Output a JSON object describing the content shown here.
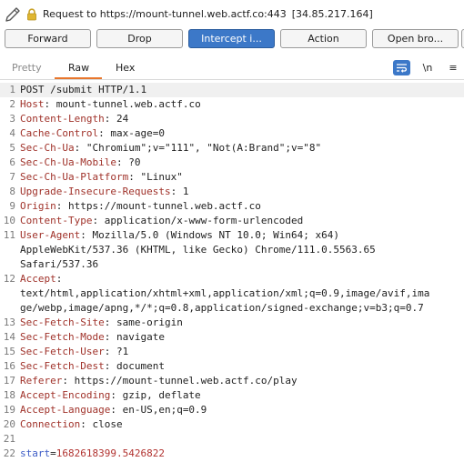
{
  "request_bar": {
    "text": "Request to https://mount-tunnel.web.actf.co:443",
    "address": "[34.85.217.164]"
  },
  "buttons": {
    "forward": "Forward",
    "drop": "Drop",
    "intercept": "Intercept i...",
    "action": "Action",
    "open_browser": "Open bro..."
  },
  "tabs": {
    "pretty": "Pretty",
    "raw": "Raw",
    "hex": "Hex"
  },
  "tools": {
    "newline": "\\n",
    "menu": "≡"
  },
  "colors": {
    "accent": "#3c78c8",
    "tab_underline": "#e8762c",
    "header_name": "#a0322a",
    "param_name": "#3d5cc6",
    "param_value": "#b1322f"
  },
  "lines": [
    {
      "n": "1",
      "plain": "POST /submit HTTP/1.1"
    },
    {
      "n": "2",
      "key": "Host",
      "val": "mount-tunnel.web.actf.co"
    },
    {
      "n": "3",
      "key": "Content-Length",
      "val": "24"
    },
    {
      "n": "4",
      "key": "Cache-Control",
      "val": "max-age=0"
    },
    {
      "n": "5",
      "key": "Sec-Ch-Ua",
      "val": "\"Chromium\";v=\"111\", \"Not(A:Brand\";v=\"8\""
    },
    {
      "n": "6",
      "key": "Sec-Ch-Ua-Mobile",
      "val": "?0"
    },
    {
      "n": "7",
      "key": "Sec-Ch-Ua-Platform",
      "val": "\"Linux\""
    },
    {
      "n": "8",
      "key": "Upgrade-Insecure-Requests",
      "val": "1"
    },
    {
      "n": "9",
      "key": "Origin",
      "val": "https://mount-tunnel.web.actf.co"
    },
    {
      "n": "10",
      "key": "Content-Type",
      "val": "application/x-www-form-urlencoded"
    },
    {
      "n": "11",
      "key": "User-Agent",
      "val": "Mozilla/5.0 (Windows NT 10.0; Win64; x64)"
    },
    {
      "n": "",
      "plain": "AppleWebKit/537.36 (KHTML, like Gecko) Chrome/111.0.5563.65"
    },
    {
      "n": "",
      "plain": "Safari/537.36"
    },
    {
      "n": "12",
      "key": "Accept",
      "val": ""
    },
    {
      "n": "",
      "plain": "text/html,application/xhtml+xml,application/xml;q=0.9,image/avif,ima"
    },
    {
      "n": "",
      "plain": "ge/webp,image/apng,*/*;q=0.8,application/signed-exchange;v=b3;q=0.7"
    },
    {
      "n": "13",
      "key": "Sec-Fetch-Site",
      "val": "same-origin"
    },
    {
      "n": "14",
      "key": "Sec-Fetch-Mode",
      "val": "navigate"
    },
    {
      "n": "15",
      "key": "Sec-Fetch-User",
      "val": "?1"
    },
    {
      "n": "16",
      "key": "Sec-Fetch-Dest",
      "val": "document"
    },
    {
      "n": "17",
      "key": "Referer",
      "val": "https://mount-tunnel.web.actf.co/play"
    },
    {
      "n": "18",
      "key": "Accept-Encoding",
      "val": "gzip, deflate"
    },
    {
      "n": "19",
      "key": "Accept-Language",
      "val": "en-US,en;q=0.9"
    },
    {
      "n": "20",
      "key": "Connection",
      "val": "close"
    },
    {
      "n": "21",
      "plain": ""
    },
    {
      "n": "22",
      "param_key": "start",
      "param_val": "1682618399.5426822"
    }
  ]
}
